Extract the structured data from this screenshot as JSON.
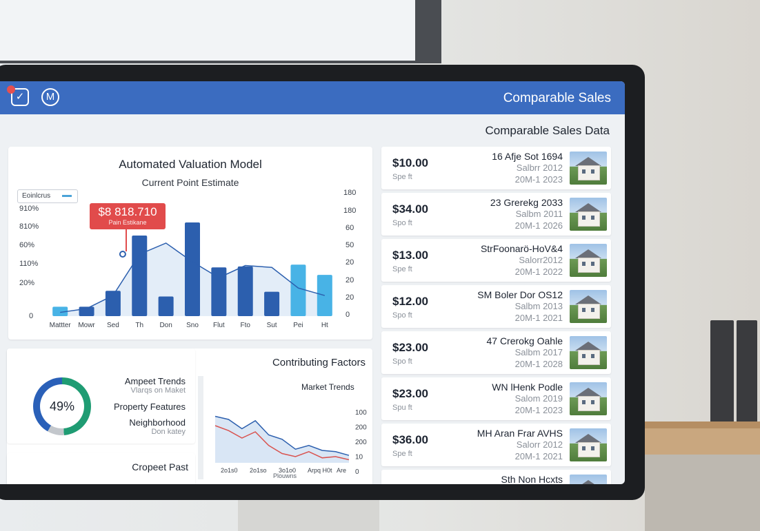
{
  "window": {
    "title": "Comparable Sales"
  },
  "section_title": "Comparable Sales Data",
  "comparables": [
    {
      "price": "$10.00",
      "unit": "Spe ft",
      "address": "16 Afje Sot 1694",
      "line2": "Salbrr 2012",
      "line3": "20M-1 2023"
    },
    {
      "price": "$34.00",
      "unit": "Spo ft",
      "address": "23 Grerekg 2033",
      "line2": "Salbm 2011",
      "line3": "20M-1 2026"
    },
    {
      "price": "$13.00",
      "unit": "Spe ft",
      "address": "StrFoonarö-HoV&4",
      "line2": "Salorr2012",
      "line3": "20M-1 2022"
    },
    {
      "price": "$12.00",
      "unit": "Spo ft",
      "address": "SM Boler Dor OS12",
      "line2": "Salbm 2013",
      "line3": "20M-1 2021"
    },
    {
      "price": "$23.00",
      "unit": "Spo ft",
      "address": "47 Crerokg Oahle",
      "line2": "Salbm 2017",
      "line3": "20M-1 2028"
    },
    {
      "price": "$23.00",
      "unit": "Spu ft",
      "address": "WN lHenk Podle",
      "line2": "Salom 2019",
      "line3": "20M-1 2023"
    },
    {
      "price": "$36.00",
      "unit": "Spe ft",
      "address": "MH Aran Frar AVHS",
      "line2": "Salorr 2012",
      "line3": "20M-1 2021"
    },
    {
      "price": "",
      "unit": "",
      "address": "Sth Non Hcxts",
      "line2": "",
      "line3": ""
    }
  ],
  "avm": {
    "title": "Automated Valuation Model",
    "subtitle": "Current Point Estimate",
    "legend_label": "Eoinlcrus",
    "estimate_value": "$8 818.710",
    "estimate_label": "Pain Estikane",
    "left_axis": [
      "910%",
      "810%",
      "60%",
      "110%",
      "20%",
      "0"
    ],
    "right_axis": [
      "180",
      "180",
      "60",
      "50",
      "20",
      "20",
      "20",
      "0"
    ]
  },
  "chart_data": {
    "type": "bar",
    "categories": [
      "Mattter",
      "Mowr",
      "Sed",
      "Th",
      "Don",
      "Sno",
      "Flut",
      "Fto",
      "Sut",
      "Pei",
      "Ht"
    ],
    "values": [
      10,
      10,
      27,
      86,
      21,
      100,
      52,
      53,
      26,
      55,
      44
    ],
    "bar_colors": [
      "#48b3e6",
      "#2c5fae",
      "#2c5fae",
      "#2c5fae",
      "#2c5fae",
      "#2c5fae",
      "#2c5fae",
      "#2c5fae",
      "#2c5fae",
      "#48b3e6",
      "#48b3e6"
    ],
    "line": [
      4,
      8,
      22,
      66,
      78,
      58,
      41,
      54,
      52,
      30,
      22
    ],
    "ylim": [
      0,
      100
    ]
  },
  "factors": {
    "title": "Contributing Factors",
    "donut_value": "49%",
    "donut_percent": 49,
    "items": [
      {
        "main": "Ampeet Trends",
        "small": "Vlarqs on Maket"
      },
      {
        "main": "Property Features",
        "small": ""
      },
      {
        "main": "Neighborhood",
        "small": "Don katey"
      }
    ],
    "trend": {
      "title": "Market Trends",
      "y_labels": [
        "100",
        "200",
        "200",
        "10",
        "0"
      ],
      "x_labels": [
        "2o1s0",
        "2o1so",
        "3o1o0",
        "Arpq H0t",
        "Are"
      ],
      "x_caption": "Plouwns",
      "series_blue": [
        75,
        70,
        55,
        68,
        45,
        38,
        22,
        28,
        20,
        18,
        12
      ],
      "series_red": [
        60,
        52,
        40,
        50,
        28,
        15,
        10,
        18,
        8,
        10,
        5
      ]
    }
  },
  "bottom": {
    "title": "Cropeet Past"
  }
}
